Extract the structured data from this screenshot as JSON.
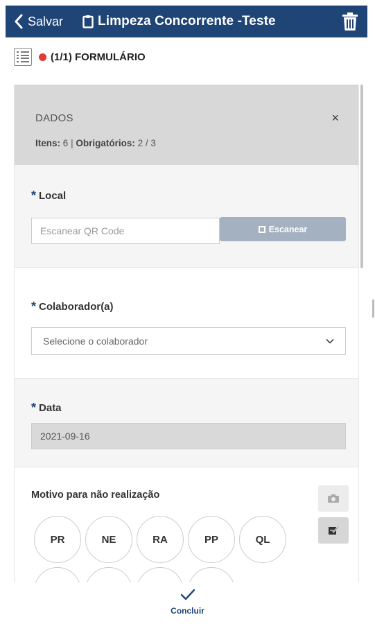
{
  "header": {
    "back_label": "Salvar",
    "title": "Limpeza Concorrente -Teste",
    "icons": [
      "chevron-left-icon",
      "clipboard-icon",
      "trash-icon"
    ],
    "bg_color": "#1f4476"
  },
  "form_row": {
    "status_color": "#e53935",
    "label": "(1/1) FORMULÁRIO"
  },
  "dados": {
    "title": "DADOS",
    "close": "×",
    "itens_label": "Itens:",
    "itens_value": "6",
    "separator": "|",
    "obrigatorios_label": "Obrigatórios:",
    "obrigatorios_value": "2 / 3"
  },
  "local": {
    "required_mark": "*",
    "label": "Local",
    "placeholder": "Escanear QR Code",
    "scan_button": "Escanear"
  },
  "colaborador": {
    "required_mark": "*",
    "label": "Colaborador(a)",
    "selected": "Selecione o colaborador"
  },
  "data": {
    "required_mark": "*",
    "label": "Data",
    "value": "2021-09-16"
  },
  "motivo": {
    "label": "Motivo para não realização",
    "options": [
      "PR",
      "NE",
      "RA",
      "PP",
      "QL",
      "",
      "",
      "",
      ""
    ]
  },
  "footer": {
    "label": "Concluir"
  }
}
